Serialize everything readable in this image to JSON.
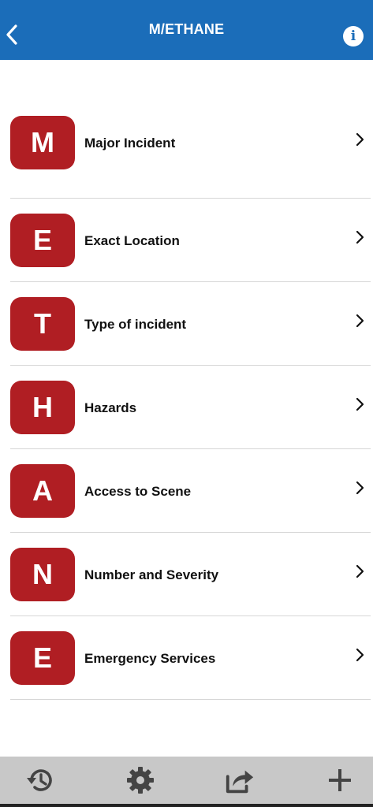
{
  "header": {
    "title": "M/ETHANE",
    "back_icon": "chevron-left-icon",
    "info_icon": "info-icon",
    "background_color": "#1b6db9"
  },
  "items": [
    {
      "letter": "M",
      "label": "Major Incident"
    },
    {
      "letter": "E",
      "label": "Exact Location"
    },
    {
      "letter": "T",
      "label": "Type of incident"
    },
    {
      "letter": "H",
      "label": "Hazards"
    },
    {
      "letter": "A",
      "label": "Access to Scene"
    },
    {
      "letter": "N",
      "label": "Number and Severity"
    },
    {
      "letter": "E",
      "label": "Emergency Services"
    }
  ],
  "accent_color": "#b01e23",
  "bottom_bar": {
    "buttons": [
      {
        "icon": "history-icon"
      },
      {
        "icon": "gear-icon"
      },
      {
        "icon": "share-icon"
      },
      {
        "icon": "plus-icon"
      }
    ],
    "background_color": "#c8c8c8"
  }
}
